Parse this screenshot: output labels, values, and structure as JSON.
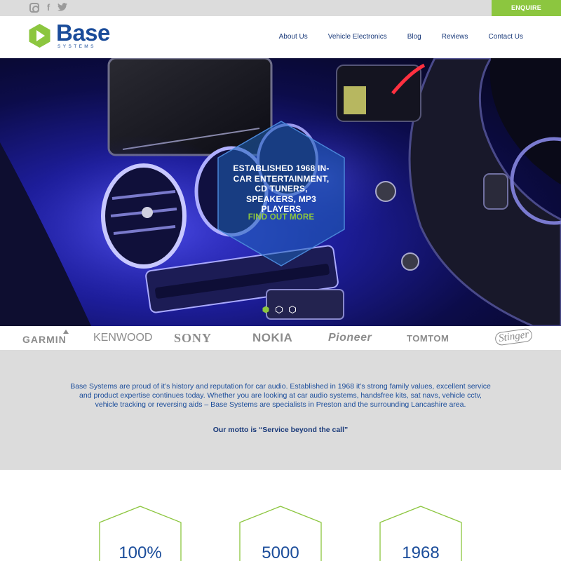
{
  "topbar": {
    "social_icons": [
      "instagram-icon",
      "facebook-icon",
      "twitter-icon"
    ],
    "enquire_label": "ENQUIRE"
  },
  "header": {
    "logo_word": "Base",
    "logo_sub": "SYSTEMS",
    "nav": [
      "About Us",
      "Vehicle Electronics",
      "Blog",
      "Reviews",
      "Contact Us"
    ]
  },
  "hero": {
    "headline": "ESTABLISHED 1968 IN-CAR ENTERTAINMENT, CD TUNERS, SPEAKERS, MP3 PLAYERS",
    "cta": "FIND OUT MORE",
    "slides_total": 3,
    "active_slide": 1
  },
  "brands": [
    "GARMIN",
    "KENWOOD",
    "SONY",
    "NOKIA",
    "Pioneer",
    "TOMTOM",
    "Stinger"
  ],
  "intro": {
    "text": "Base Systems are proud of it’s history and reputation for car audio. Established in 1968 it’s strong family values, excellent service and product expertise continues today. Whether you are looking at car audio systems, handsfree kits, sat navs, vehicle cctv, vehicle tracking or reversing aids – Base Systems are specialists in Preston and the surrounding Lancashire area.",
    "motto": "Our motto is “Service beyond the call”"
  },
  "stats": [
    "100%",
    "5000",
    "1968"
  ],
  "colors": {
    "brand_blue": "#1a4c9a",
    "accent_green": "#8cc63f",
    "band_grey": "#dcdcdc"
  }
}
